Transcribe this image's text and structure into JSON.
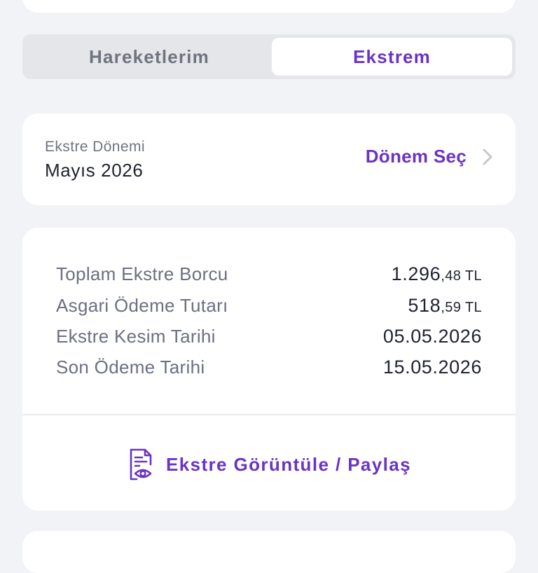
{
  "tabs": [
    {
      "label": "Hareketlerim",
      "active": false
    },
    {
      "label": "Ekstrem",
      "active": true
    }
  ],
  "period": {
    "label": "Ekstre Dönemi",
    "value": "Mayıs 2026",
    "select_label": "Dönem Seç"
  },
  "summary": {
    "rows": [
      {
        "label": "Toplam Ekstre Borcu",
        "value_main": "1.296",
        "value_decimal": ",48 TL"
      },
      {
        "label": "Asgari Ödeme Tutarı",
        "value_main": "518",
        "value_decimal": ",59 TL"
      },
      {
        "label": "Ekstre Kesim Tarihi",
        "value_main": "05.05.2026",
        "value_decimal": ""
      },
      {
        "label": "Son Ödeme Tarihi",
        "value_main": "15.05.2026",
        "value_decimal": ""
      }
    ],
    "action_label": "Ekstre Görüntüle / Paylaş"
  },
  "colors": {
    "accent": "#6a34c4",
    "background": "#f2f3f6",
    "card": "#ffffff",
    "muted_text": "#6f7480"
  },
  "icons": {
    "period_select": "chevron-right-icon",
    "action": "document-view-icon"
  }
}
